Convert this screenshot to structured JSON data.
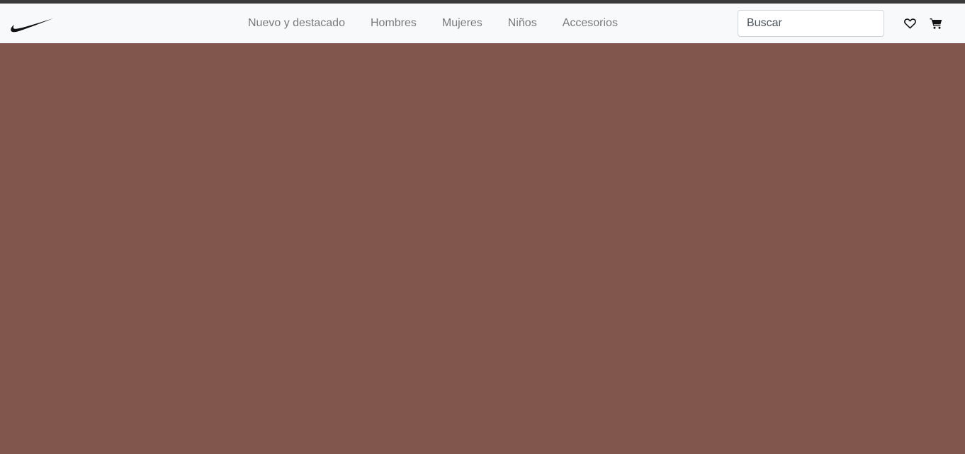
{
  "brand": {
    "logo_icon": "swoosh-logo-icon"
  },
  "nav": {
    "links": [
      {
        "label": "Nuevo y destacado"
      },
      {
        "label": "Hombres"
      },
      {
        "label": "Mujeres"
      },
      {
        "label": "Niños"
      },
      {
        "label": "Accesorios"
      }
    ]
  },
  "search": {
    "placeholder": "Buscar",
    "value": ""
  },
  "actions": {
    "favorites_icon": "heart-icon",
    "cart_icon": "cart-icon"
  },
  "colors": {
    "navbar_bg": "#f8f9fa",
    "top_strip": "#3a3a3a",
    "hero_bg": "#81564c",
    "nav_text": "#7a7a7a"
  }
}
